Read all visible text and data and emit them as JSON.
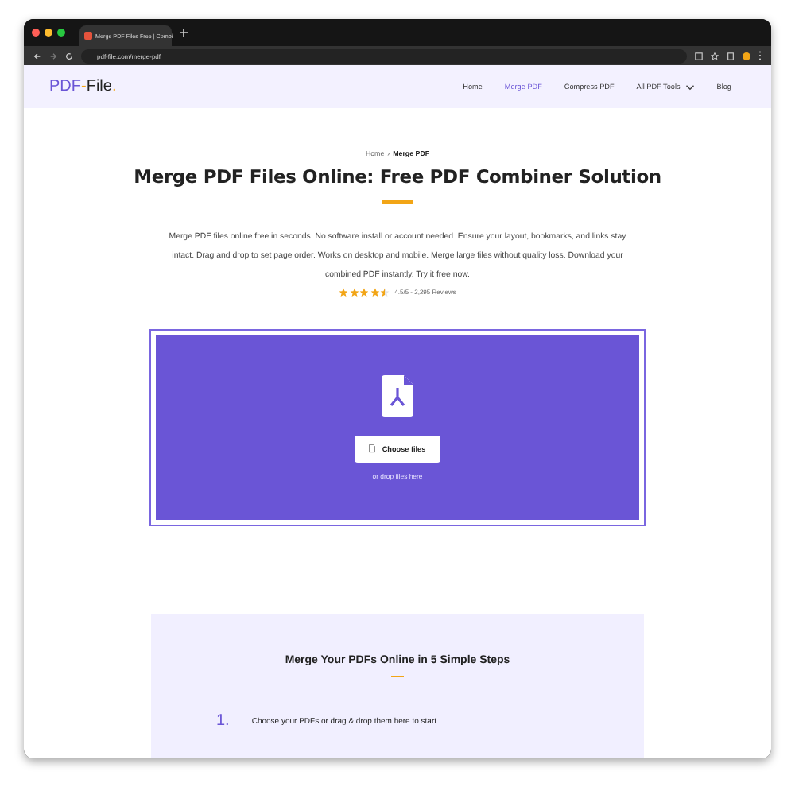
{
  "browser": {
    "tab_title": "Merge PDF Files Free | Combi",
    "url": "pdf-file.com/merge-pdf"
  },
  "site": {
    "logo_main": "PDF",
    "logo_dash": "-",
    "logo_tail": "File",
    "logo_dot": "."
  },
  "nav": [
    {
      "label": "Home",
      "selected": false,
      "dropdown": false
    },
    {
      "label": "Merge PDF",
      "selected": true,
      "dropdown": false
    },
    {
      "label": "Compress PDF",
      "selected": false,
      "dropdown": false
    },
    {
      "label": "All PDF Tools",
      "selected": false,
      "dropdown": true
    },
    {
      "label": "Blog",
      "selected": false,
      "dropdown": false
    }
  ],
  "breadcrumb": {
    "parent": "Home",
    "separator": "›",
    "current": "Merge PDF"
  },
  "title": "Merge PDF Files Online: Free PDF Combiner Solution",
  "intro": "Merge PDF files online free in seconds. No software install or account needed. Ensure your layout, bookmarks, and links stay intact. Drag and drop to set page order. Works on desktop and mobile. Merge large files without quality loss. Download your combined PDF instantly. Try it free now.",
  "rating": {
    "stars": 4.5,
    "text": "4.5/5 - 2,295 Reviews"
  },
  "dropzone": {
    "button": "Choose files",
    "hint": "or drop files here"
  },
  "steps": {
    "title": "Merge Your PDFs Online in 5 Simple Steps",
    "items": [
      {
        "number": "1.",
        "text": "Choose your PDFs or drag & drop them here to start."
      }
    ]
  }
}
